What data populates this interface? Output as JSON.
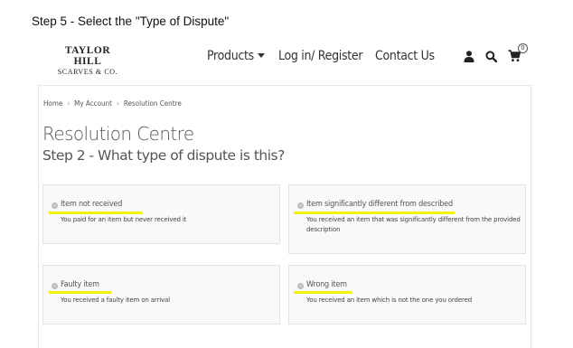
{
  "caption": "Step 5 - Select the \"Type of Dispute\"",
  "logo": {
    "line1": "TAYLOR HILL",
    "line2": "SCARVES & CO."
  },
  "nav": {
    "products": "Products",
    "login": "Log in/ Register",
    "contact": "Contact Us",
    "cart_count": "0",
    "icons": [
      "user-icon",
      "search-icon",
      "cart-icon",
      "chevron-down-icon"
    ]
  },
  "breadcrumb": [
    "Home",
    "My Account",
    "Resolution Centre"
  ],
  "page": {
    "title": "Resolution Centre",
    "subtitle": "Step 2 - What type of dispute is this?"
  },
  "options": [
    {
      "label": "Item not received",
      "description": "You paid for an item but never received it"
    },
    {
      "label": "Item significantly different from described",
      "description": "You received an item that was significantly different from the provided description"
    },
    {
      "label": "Faulty item",
      "description": "You received a faulty item on arrival"
    },
    {
      "label": "Wrong item",
      "description": "You received an item which is not the one you ordered"
    }
  ],
  "colors": {
    "highlight": "#f2f20a",
    "card_bg": "#f9f9f9",
    "border": "#e3e3e3",
    "text": "#555555"
  }
}
